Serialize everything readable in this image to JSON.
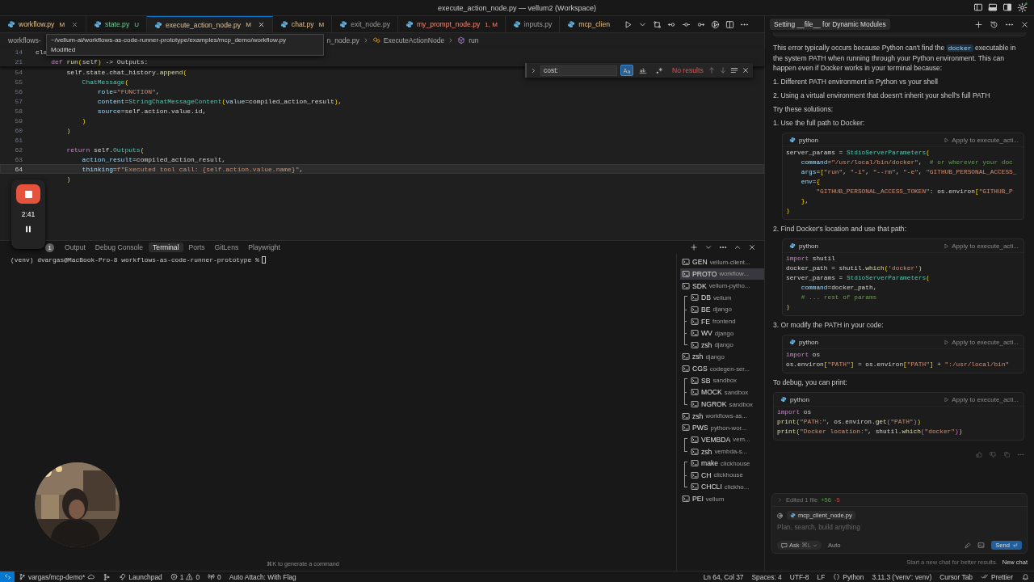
{
  "window": {
    "title": "execute_action_node.py — vellum2 (Workspace)"
  },
  "tabs": [
    {
      "label": "workflow.py",
      "badge": "M",
      "kind": "modified",
      "close": true,
      "selected": false
    },
    {
      "label": "state.py",
      "badge": "U",
      "kind": "untracked",
      "close": false,
      "selected": false
    },
    {
      "label": "execute_action_node.py",
      "badge": "M",
      "kind": "modified",
      "close": true,
      "selected": true
    },
    {
      "label": "chat.py",
      "badge": "M",
      "kind": "modified",
      "close": false,
      "selected": false
    },
    {
      "label": "exit_node.py",
      "kind": "plain",
      "close": false,
      "selected": false
    },
    {
      "label": "my_prompt_node.py",
      "badge": "1, M",
      "kind": "error",
      "close": false,
      "selected": false
    },
    {
      "label": "inputs.py",
      "kind": "plain",
      "close": false,
      "selected": false
    },
    {
      "label": "mcp_clien",
      "kind": "modified",
      "close": false,
      "selected": false
    }
  ],
  "breadcrumb": [
    {
      "label": "workflows-",
      "kind": "text"
    },
    {
      "label": "n_node.py",
      "kind": "text"
    },
    {
      "label": "ExecuteActionNode",
      "kind": "class"
    },
    {
      "label": "run",
      "kind": "method"
    }
  ],
  "tooltip": {
    "path": "~/vellum-ai/workflows-as-code-runner-prototype/examples/mcp_demo/workflow.py",
    "status": "Modified"
  },
  "sticky_lines": [
    {
      "number": "14",
      "text": "cla"
    },
    {
      "number": "21",
      "text": "    def run(self) -> Outputs:"
    }
  ],
  "code_lines": [
    {
      "number": "54",
      "text": "        self.state.chat_history.append(",
      "current": false
    },
    {
      "number": "55",
      "text": "            ChatMessage(",
      "current": false
    },
    {
      "number": "56",
      "text": "                role=\"FUNCTION\",",
      "current": false
    },
    {
      "number": "57",
      "text": "                content=StringChatMessageContent(value=compiled_action_result),",
      "current": false
    },
    {
      "number": "58",
      "text": "                source=self.action.value.id,",
      "current": false
    },
    {
      "number": "59",
      "text": "            )",
      "current": false
    },
    {
      "number": "60",
      "text": "        )",
      "current": false
    },
    {
      "number": "61",
      "current": false
    },
    {
      "number": "62",
      "text": "        return self.Outputs(",
      "current": false
    },
    {
      "number": "63",
      "text": "            action_result=compiled_action_result,",
      "current": false
    },
    {
      "number": "64",
      "text": "            thinking=f\"Executed tool call: {self.action.value.name}\",",
      "current": true
    },
    {
      "text": "        )",
      "current": false
    }
  ],
  "find": {
    "value": "cost:",
    "match_case": true,
    "whole_word": false,
    "regex": false,
    "result": "No results"
  },
  "recording": {
    "time": "2:41"
  },
  "panel": {
    "problems_badge": "1",
    "tabs": [
      {
        "label": "Output",
        "selected": false
      },
      {
        "label": "Debug Console",
        "selected": false
      },
      {
        "label": "Terminal",
        "selected": true
      },
      {
        "label": "Ports",
        "selected": false
      },
      {
        "label": "GitLens",
        "selected": false
      },
      {
        "label": "Playwright",
        "selected": false
      }
    ],
    "prompt": "(venv) dvargas@MacBook-Pro-8 workflows-as-code-runner-prototype %",
    "hint": "⌘K to generate a command"
  },
  "terminals": [
    {
      "name": "GEN",
      "cwd": "vellum-client...",
      "selected": false
    },
    {
      "name": "PROTO",
      "cwd": "workflow...",
      "selected": true
    },
    {
      "name": "SDK",
      "cwd": "vellum-pytho...",
      "selected": false
    },
    {
      "kind": "group",
      "children": [
        {
          "name": "DB",
          "cwd": "vellum",
          "selected": false
        },
        {
          "name": "BE",
          "cwd": "django",
          "selected": false
        },
        {
          "name": "FE",
          "cwd": "frontend",
          "selected": false
        },
        {
          "name": "WV",
          "cwd": "django",
          "selected": false
        },
        {
          "name": "zsh",
          "cwd": "django",
          "selected": false
        }
      ]
    },
    {
      "name": "zsh",
      "cwd": "django",
      "selected": false
    },
    {
      "name": "CGS",
      "cwd": "codegen-ser...",
      "selected": false
    },
    {
      "kind": "group",
      "children": [
        {
          "name": "SB",
          "cwd": "sandbox",
          "selected": false
        },
        {
          "name": "MOCK",
          "cwd": "sandbox",
          "selected": false
        },
        {
          "name": "NGROK",
          "cwd": "sandbox",
          "selected": false
        }
      ]
    },
    {
      "name": "zsh",
      "cwd": "workflows-as...",
      "selected": false
    },
    {
      "name": "PWS",
      "cwd": "python-wor...",
      "selected": false
    },
    {
      "kind": "group",
      "children": [
        {
          "name": "VEMBDA",
          "cwd": "vem...",
          "selected": false
        },
        {
          "name": "zsh",
          "cwd": "vembda-s...",
          "selected": false
        }
      ]
    },
    {
      "kind": "group",
      "children": [
        {
          "name": "make",
          "cwd": "clickhouse",
          "selected": false
        },
        {
          "name": "CH",
          "cwd": "clickhouse",
          "selected": false
        },
        {
          "name": "CHCLI",
          "cwd": "clickho...",
          "selected": false
        }
      ]
    },
    {
      "name": "PEI",
      "cwd": "vellum",
      "selected": false
    }
  ],
  "chat": {
    "title": "Setting __file__ for Dynamic Modules",
    "blocks": [
      {
        "kind": "paragraph",
        "parts": [
          {
            "text": "This error typically occurs because Python can't find the "
          },
          {
            "code": "docker"
          },
          {
            "text": " executable in the system PATH when running through your Python environment. This can happen even if Docker works in your terminal because:"
          }
        ]
      },
      {
        "kind": "list_item",
        "text": "1. Different PATH environment in Python vs your shell"
      },
      {
        "kind": "list_item",
        "text": "2. Using a virtual environment that doesn't inherit your shell's full PATH"
      },
      {
        "kind": "paragraph",
        "parts": [
          {
            "text": "Try these solutions:"
          }
        ]
      },
      {
        "kind": "list_item",
        "text": "1. Use the full path to Docker:"
      },
      {
        "kind": "code",
        "indented": true,
        "language": "python",
        "apply": "Apply to execute_acti...",
        "lines": [
          "server_params = StdioServerParameters(",
          "    command=\"/usr/local/bin/docker\",  # or wherever your doc",
          "    args=[\"run\", \"-i\", \"--rm\", \"-e\", \"GITHUB_PERSONAL_ACCESS_",
          "    env={",
          "        \"GITHUB_PERSONAL_ACCESS_TOKEN\": os.environ[\"GITHUB_P",
          "    },",
          ")"
        ]
      },
      {
        "kind": "list_item",
        "text": "2. Find Docker's location and use that path:"
      },
      {
        "kind": "code",
        "indented": true,
        "language": "python",
        "apply": "Apply to execute_acti...",
        "lines": [
          "import shutil",
          "docker_path = shutil.which('docker')",
          "server_params = StdioServerParameters(",
          "    command=docker_path,",
          "    # ... rest of params",
          ")"
        ]
      },
      {
        "kind": "list_item",
        "text": "3. Or modify the PATH in your code:"
      },
      {
        "kind": "code",
        "indented": true,
        "language": "python",
        "apply": "Apply to execute_acti...",
        "lines": [
          "import os",
          "os.environ[\"PATH\"] = os.environ[\"PATH\"] + \":/usr/local/bin\""
        ]
      },
      {
        "kind": "paragraph",
        "parts": [
          {
            "text": "To debug, you can print:"
          }
        ]
      },
      {
        "kind": "code",
        "indented": false,
        "language": "python",
        "apply": "Apply to execute_acti...",
        "lines": [
          "import os",
          "print(\"PATH:\", os.environ.get(\"PATH\"))",
          "print(\"Docker location:\", shutil.which(\"docker\"))"
        ]
      }
    ],
    "edited": {
      "label": "Edited 1 file",
      "added": "+56",
      "removed": "-5"
    },
    "context_file": "mcp_client_node.py",
    "input": {
      "placeholder": "Plan, search, build anything"
    },
    "mode": "Ask",
    "mode_shortcut": "⌘L",
    "model": "Auto",
    "send": "Send",
    "footer": "Start a new chat for better results.",
    "new_chat": "New chat"
  },
  "status_bar": {
    "left": [
      {
        "kind": "remote"
      },
      {
        "kind": "branch",
        "text": "vargas/mcp-demo*"
      },
      {
        "kind": "sync"
      },
      {
        "kind": "launchpad",
        "text": "Launchpad"
      },
      {
        "kind": "problems",
        "errors": "1",
        "warnings": "0"
      },
      {
        "kind": "ports",
        "text": "0"
      },
      {
        "kind": "text",
        "text": "Auto Attach: With Flag"
      }
    ],
    "right": [
      {
        "kind": "text",
        "text": "Ln 64, Col 37"
      },
      {
        "kind": "text",
        "text": "Spaces: 4"
      },
      {
        "kind": "text",
        "text": "UTF-8"
      },
      {
        "kind": "text",
        "text": "LF"
      },
      {
        "kind": "language",
        "text": "Python"
      },
      {
        "kind": "text",
        "text": "3.11.3 ('venv': venv)"
      },
      {
        "kind": "text",
        "text": "Cursor Tab"
      },
      {
        "kind": "prettier",
        "text": "Prettier"
      },
      {
        "kind": "bell"
      }
    ]
  }
}
